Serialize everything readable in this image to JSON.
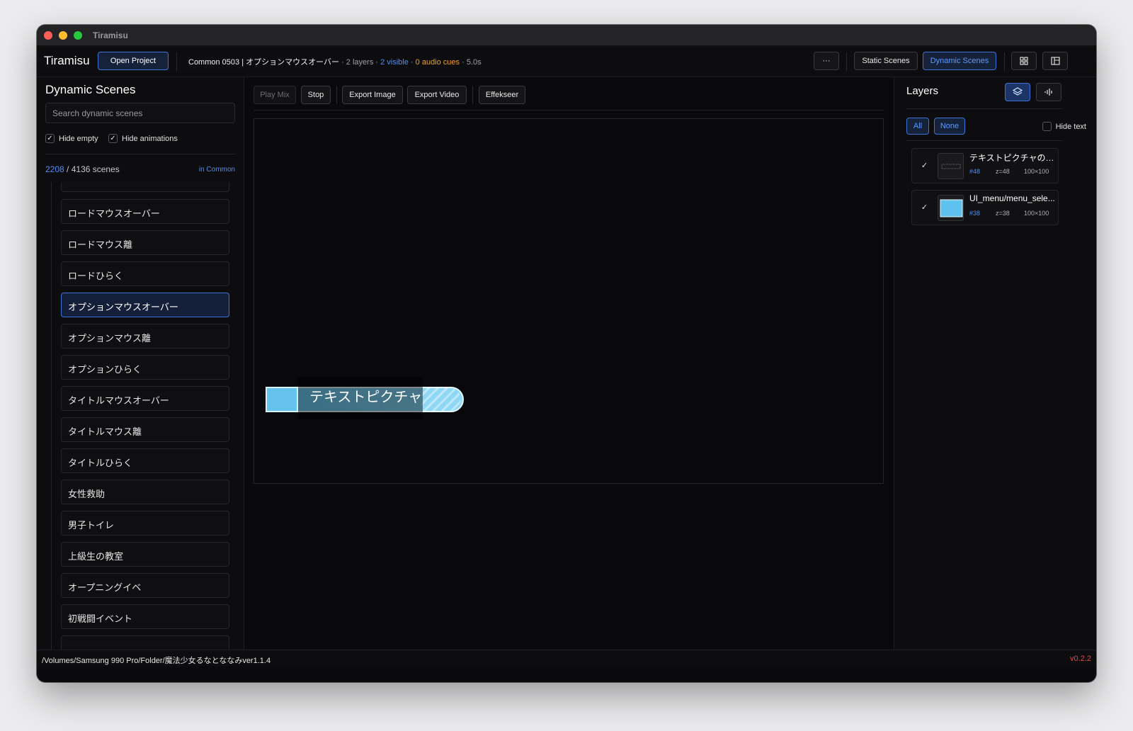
{
  "window": {
    "title": "Tiramisu"
  },
  "header": {
    "app_name": "Tiramisu",
    "open_project": "Open Project",
    "project_info": "Common 0503 | オプションマウスオーバー",
    "layers_info": "· 2 layers ·",
    "visible_info": "2 visible",
    "audio_info": "0 audio cues",
    "duration_info": "· 5.0s",
    "more_label": "···",
    "static_scenes": "Static Scenes",
    "dynamic_scenes": "Dynamic Scenes",
    "icons": [
      "more-icon",
      "grid-icon",
      "panel-icon"
    ]
  },
  "sidebar": {
    "title": "Dynamic Scenes",
    "search_placeholder": "Search dynamic scenes",
    "filters": [
      {
        "label": "Hide empty",
        "checked": true
      },
      {
        "label": "Hide animations",
        "checked": true
      }
    ],
    "count": "2208",
    "count_total": "/ 4136 scenes",
    "scope": "in Common",
    "scenes": [
      {
        "label": "ロードマウスオーバー"
      },
      {
        "label": "ロードマウス離"
      },
      {
        "label": "ロードひらく"
      },
      {
        "label": "オプションマウスオーバー",
        "active": true
      },
      {
        "label": "オプションマウス離"
      },
      {
        "label": "オプションひらく"
      },
      {
        "label": "タイトルマウスオーバー"
      },
      {
        "label": "タイトルマウス離"
      },
      {
        "label": "タイトルひらく"
      },
      {
        "label": "女性救助"
      },
      {
        "label": "男子トイレ"
      },
      {
        "label": "上級生の教室"
      },
      {
        "label": "オープニングイベ"
      },
      {
        "label": "初戦闘イベント"
      }
    ]
  },
  "toolbar": {
    "play_mix": "Play Mix",
    "stop": "Stop",
    "export_image": "Export Image",
    "export_video": "Export Video",
    "effekseer": "Effekseer"
  },
  "preview": {
    "banner_text": "テキストピクチャ"
  },
  "layers": {
    "title": "Layers",
    "all": "All",
    "none": "None",
    "hide_text": "Hide text",
    "items": [
      {
        "name": "テキストピクチャの設...",
        "id": "#48",
        "z": "z=48",
        "size": "100×100",
        "checked": true
      },
      {
        "name": "UI_menu/menu_sele...",
        "id": "#38",
        "z": "z=38",
        "size": "100×100",
        "checked": true
      }
    ]
  },
  "footer": {
    "path": "/Volumes/Samsung 990 Pro/Folder/魔法少女るなとななみver1.1.4",
    "version": "v0.2.2"
  },
  "colors": {
    "accent": "#4f8ff7",
    "audio": "#f0a028",
    "version": "#e04848",
    "background": "#0a0a0d"
  }
}
